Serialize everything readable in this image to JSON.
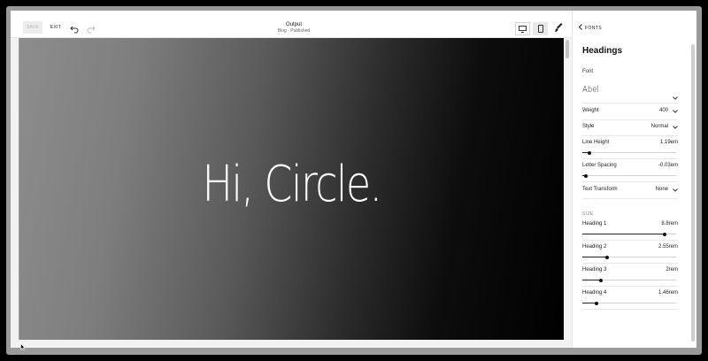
{
  "toolbar": {
    "save_label": "SAVE",
    "exit_label": "EXIT",
    "title": "Output",
    "subtitle": "Blog · Published"
  },
  "preview": {
    "heading": "Hi, Circle."
  },
  "panel": {
    "back_label": "FONTS",
    "title": "Headings",
    "font_label": "Font",
    "font_value": "Abel",
    "weight": {
      "label": "Weight",
      "value": "400"
    },
    "style": {
      "label": "Style",
      "value": "Normal"
    },
    "line_height": {
      "label": "Line Height",
      "value": "1.19em",
      "level": 0.08
    },
    "letter_spacing": {
      "label": "Letter Spacing",
      "value": "-0.03em",
      "level": 0.04
    },
    "text_transform": {
      "label": "Text Transform",
      "value": "None"
    },
    "size_label": "SIZE",
    "headings": [
      {
        "label": "Heading 1",
        "value": "8.8rem",
        "level": 0.88
      },
      {
        "label": "Heading 2",
        "value": "2.55rem",
        "level": 0.26
      },
      {
        "label": "Heading 3",
        "value": "2rem",
        "level": 0.2
      },
      {
        "label": "Heading 4",
        "value": "1.46rem",
        "level": 0.15
      }
    ]
  },
  "colors": {
    "accent": "#111111",
    "preview_left": "#8d8d8d",
    "preview_right": "#000000",
    "edge_highlight": "#7ea3d8"
  },
  "icons": [
    "undo-icon",
    "redo-icon",
    "desktop-icon",
    "mobile-icon",
    "style-brush-icon",
    "chevron-left-icon",
    "chevron-down-icon",
    "cursor-icon"
  ]
}
